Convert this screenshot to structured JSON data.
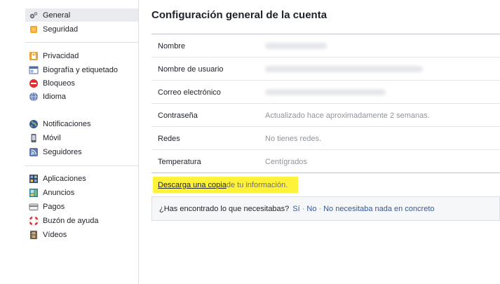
{
  "sidebar": {
    "items": [
      {
        "label": "General",
        "icon": "gears-icon"
      },
      {
        "label": "Seguridad",
        "icon": "badge-icon"
      },
      {
        "label": "Privacidad",
        "icon": "lock-icon"
      },
      {
        "label": "Biografía y etiquetado",
        "icon": "timeline-icon"
      },
      {
        "label": "Bloqueos",
        "icon": "block-icon"
      },
      {
        "label": "Idioma",
        "icon": "globe-icon"
      },
      {
        "label": "Notificaciones",
        "icon": "world-icon"
      },
      {
        "label": "Móvil",
        "icon": "phone-icon"
      },
      {
        "label": "Seguidores",
        "icon": "rss-icon"
      },
      {
        "label": "Aplicaciones",
        "icon": "apps-icon"
      },
      {
        "label": "Anuncios",
        "icon": "ads-icon"
      },
      {
        "label": "Pagos",
        "icon": "card-icon"
      },
      {
        "label": "Buzón de ayuda",
        "icon": "lifebuoy-icon"
      },
      {
        "label": "Vídeos",
        "icon": "film-icon"
      }
    ]
  },
  "main": {
    "title": "Configuración general de la cuenta",
    "rows": [
      {
        "label": "Nombre",
        "value": ""
      },
      {
        "label": "Nombre de usuario",
        "value": ""
      },
      {
        "label": "Correo electrónico",
        "value": ""
      },
      {
        "label": "Contraseña",
        "value": "Actualizado hace aproximadamente 2 semanas."
      },
      {
        "label": "Redes",
        "value": "No tienes redes."
      },
      {
        "label": "Temperatura",
        "value": "Centígrados"
      }
    ],
    "download": {
      "link": "Descarga una copia",
      "rest": " de tu información."
    },
    "feedback": {
      "question": "¿Has encontrado lo que necesitabas?",
      "yes": "Sí",
      "no": "No",
      "nothing": "No necesitaba nada en concreto"
    }
  },
  "colors": {
    "highlight": "#fff23a",
    "link": "#365899",
    "active_bg": "#e9ebee"
  }
}
